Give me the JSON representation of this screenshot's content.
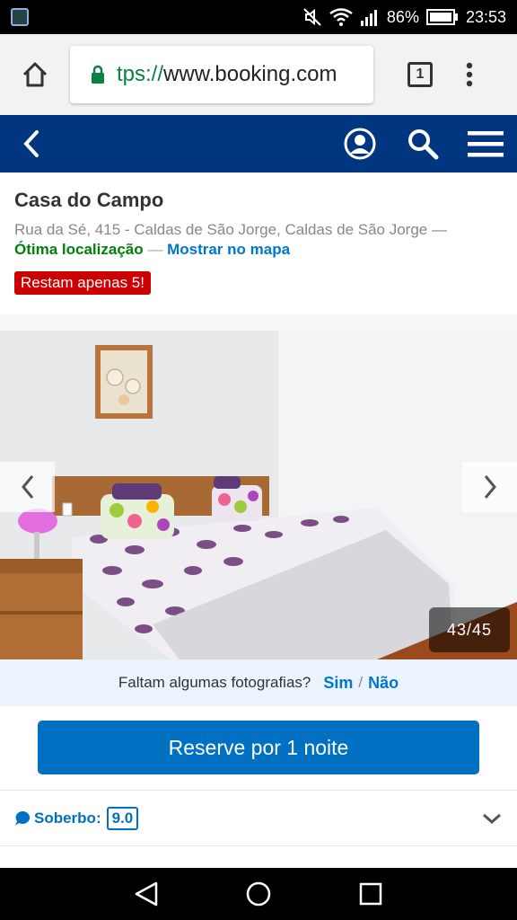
{
  "status_bar": {
    "battery": "86%",
    "time": "23:53"
  },
  "browser": {
    "url_scheme": "tps://",
    "url_host": "www.booking.com",
    "tab_count": "1"
  },
  "hotel": {
    "name": "Casa do Campo",
    "address": "Rua da Sé, 415 - Caldas de São Jorge, Caldas de São Jorge —",
    "location_label": "Ótima localização",
    "location_sep": " — ",
    "map_link": "Mostrar no mapa",
    "availability_badge": "Restam apenas 5!"
  },
  "gallery": {
    "counter": "43/45"
  },
  "missing_photos": {
    "question": "Faltam algumas fotografias?",
    "yes": "Sim",
    "separator": "/",
    "no": "Não"
  },
  "reserve": {
    "label": "Reserve por 1 noite"
  },
  "rating": {
    "word": "Soberbo:",
    "score": "9.0"
  },
  "colors": {
    "booking_blue": "#003580",
    "button_blue": "#0071c2",
    "link_blue": "#0077cc",
    "green": "#008009",
    "badge_red": "#cc0000"
  }
}
